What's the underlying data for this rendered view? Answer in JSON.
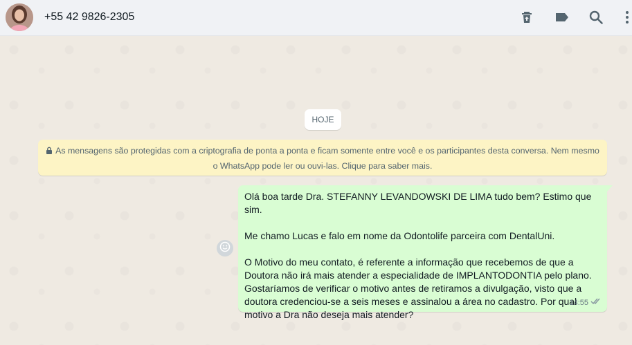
{
  "header": {
    "contact_name": "+55 42 9826-2305",
    "icons": [
      "delete-icon",
      "label-icon",
      "search-icon",
      "menu-icon"
    ]
  },
  "chat": {
    "date_separator": "HOJE",
    "encryption_notice_line1": "As mensagens são protegidas com a criptografia de ponta a ponta e ficam somente entre você e os participantes desta conversa. Nem mesmo",
    "encryption_notice_line2": "o WhatsApp pode ler ou ouvi-las. Clique para saber mais.",
    "message": {
      "line1": "Olá boa tarde Dra. STEFANNY LEVANDOWSKI DE LIMA tudo bem? Estimo que sim.",
      "line2": "Me chamo Lucas e falo em nome da Odontolife parceira com DentalUni.",
      "line3": "O Motivo do meu contato, é referente a informação que recebemos de que a",
      "line4": "Doutora não irá mais atender a especialidade de IMPLANTODONTIA pelo plano.",
      "line5": "Gostaríamos de verificar o motivo antes de retiramos a divulgação, visto que a",
      "line6": "doutora credenciou-se a seis meses e assinalou a área no cadastro. Por qual",
      "line7": "motivo a Dra não deseja mais atender?",
      "time": "14:55",
      "status_icon": "double-check-icon"
    }
  },
  "colors": {
    "header_bg": "#f0f2f5",
    "chat_bg": "#efeae2",
    "outgoing_bubble": "#d9fdd3",
    "notice_bg": "#fdf4c5",
    "icon_gray": "#54656f"
  }
}
